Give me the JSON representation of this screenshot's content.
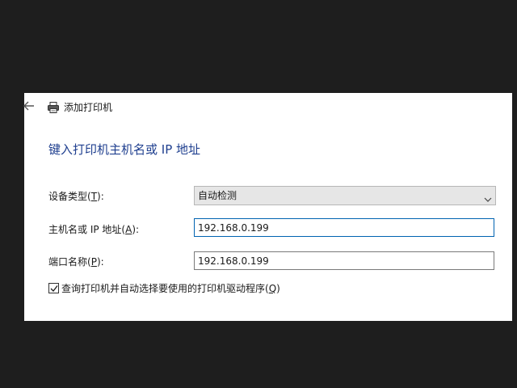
{
  "window": {
    "title": "添加打印机"
  },
  "page": {
    "heading": "键入打印机主机名或 IP 地址"
  },
  "form": {
    "device_type": {
      "label_prefix": "设备类型(",
      "label_key": "T",
      "label_suffix": "):",
      "value": "自动检测"
    },
    "hostname": {
      "label_prefix": "主机名或 IP 地址(",
      "label_key": "A",
      "label_suffix": "):",
      "value": "192.168.0.199"
    },
    "port_name": {
      "label_prefix": "端口名称(",
      "label_key": "P",
      "label_suffix": "):",
      "value": "192.168.0.199"
    },
    "query_printer": {
      "checked": true,
      "label_prefix": "查询打印机并自动选择要使用的打印机驱动程序(",
      "label_key": "Q",
      "label_suffix": ")"
    }
  },
  "colors": {
    "heading": "#1f3f8f",
    "focus_border": "#0063b1",
    "background": "#1e1e1e"
  }
}
